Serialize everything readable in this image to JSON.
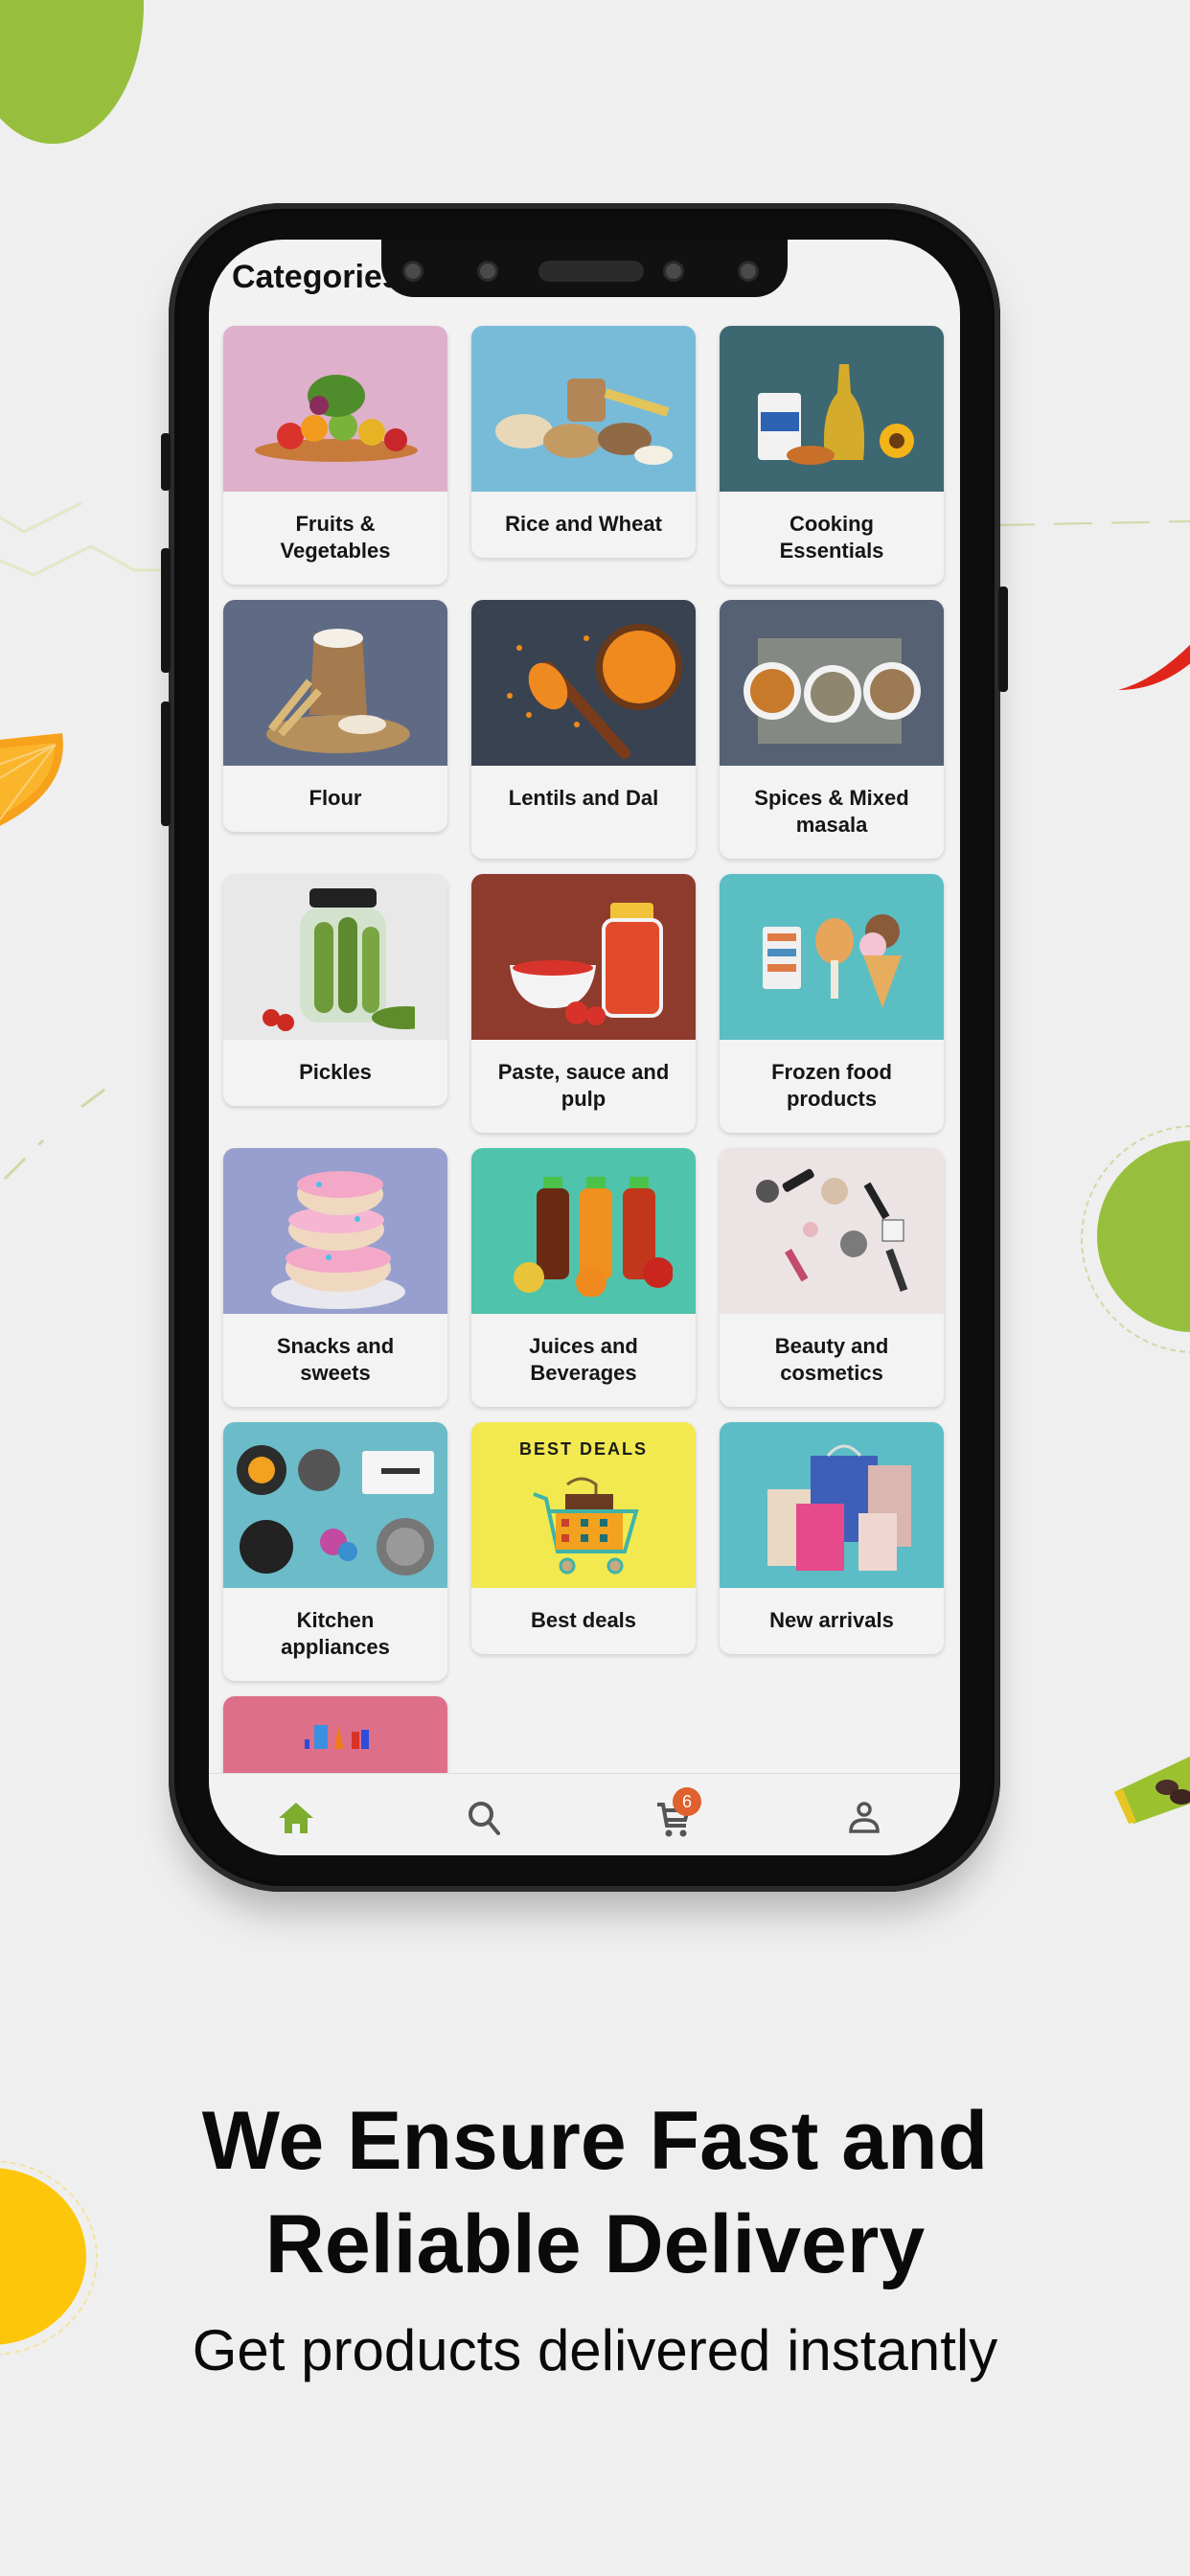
{
  "screen": {
    "title": "Categories",
    "categories": [
      {
        "label": "Fruits & Vegetables",
        "image_bg": "#dfb0cc",
        "icon": "fruits-vegetables-image"
      },
      {
        "label": "Rice and Wheat",
        "image_bg": "#78bbd9",
        "icon": "rice-wheat-image"
      },
      {
        "label": "Cooking Essentials",
        "image_bg": "#3d6872",
        "icon": "cooking-essentials-image"
      },
      {
        "label": "Flour",
        "image_bg": "#5f6a84",
        "icon": "flour-image"
      },
      {
        "label": "Lentils and Dal",
        "image_bg": "#394250",
        "icon": "lentils-dal-image"
      },
      {
        "label": "Spices & Mixed masala",
        "image_bg": "#566174",
        "icon": "spices-image"
      },
      {
        "label": "Pickles",
        "image_bg": "#e8e8e8",
        "icon": "pickles-image"
      },
      {
        "label": "Paste, sauce and pulp",
        "image_bg": "#8e3a2c",
        "icon": "paste-sauce-image"
      },
      {
        "label": "Frozen food products",
        "image_bg": "#5bbec3",
        "icon": "frozen-food-image"
      },
      {
        "label": "Snacks and sweets",
        "image_bg": "#979fcf",
        "icon": "snacks-sweets-image"
      },
      {
        "label": "Juices and Beverages",
        "image_bg": "#4fc3ab",
        "icon": "juices-image"
      },
      {
        "label": "Beauty and cosmetics",
        "image_bg": "#ece4e4",
        "icon": "cosmetics-image"
      },
      {
        "label": "Kitchen appliances",
        "image_bg": "#6bbcc8",
        "icon": "kitchen-appliances-image"
      },
      {
        "label": "Best deals",
        "image_bg": "#f1e94f",
        "icon": "best-deals-image",
        "image_text": "BEST DEALS"
      },
      {
        "label": "New arrivals",
        "image_bg": "#5cbdc6",
        "icon": "new-arrivals-image"
      },
      {
        "label": "",
        "image_bg": "#de6f8a",
        "icon": "toys-image"
      }
    ],
    "bottom_nav": {
      "items": [
        {
          "name": "home",
          "icon": "home-icon",
          "active": true
        },
        {
          "name": "search",
          "icon": "search-icon",
          "active": false
        },
        {
          "name": "cart",
          "icon": "cart-icon",
          "active": false,
          "badge": "6"
        },
        {
          "name": "profile",
          "icon": "profile-icon",
          "active": false
        }
      ],
      "active_color": "#7cad2f",
      "inactive_color": "#555555",
      "badge_color": "#e0602e"
    }
  },
  "promo": {
    "headline_line1": "We Ensure Fast and",
    "headline_line2": "Reliable Delivery",
    "subheadline": "Get products delivered instantly"
  },
  "colors": {
    "background": "#efefef",
    "accent_green": "#97bf3d",
    "accent_yellow": "#fdc60b"
  }
}
